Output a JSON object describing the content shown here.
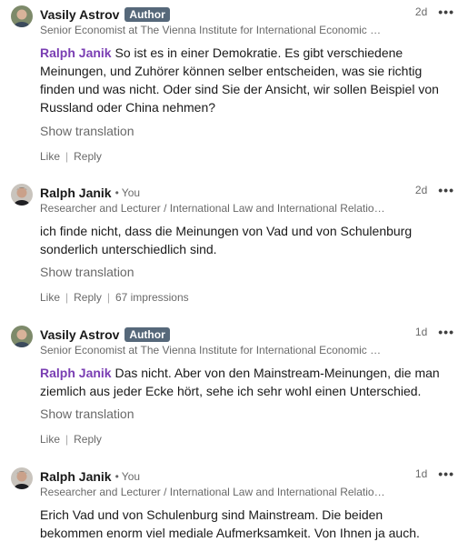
{
  "comments": [
    {
      "author": "Vasily Astrov",
      "badge": "Author",
      "you": "",
      "headline": "Senior Economist at The Vienna Institute for International Economic Studies",
      "time": "2d",
      "mention": "Ralph Janik",
      "text": "So ist es in einer Demokratie. Es gibt verschiedene Meinungen, und Zuhörer können selber entscheiden, was sie richtig finden und was nicht. Oder sind Sie der Ansicht, wir sollen Beispiel von Russland oder China nehmen?",
      "show_translation": "Show translation",
      "like": "Like",
      "reply": "Reply",
      "impressions": ""
    },
    {
      "author": "Ralph Janik",
      "badge": "",
      "you": "You",
      "headline": "Researcher and Lecturer / International Law and International Relations",
      "time": "2d",
      "mention": "",
      "text": "ich finde nicht, dass die Meinungen von Vad und von Schulenburg sonderlich unterschiedlich sind.",
      "show_translation": "Show translation",
      "like": "Like",
      "reply": "Reply",
      "impressions": "67 impressions"
    },
    {
      "author": "Vasily Astrov",
      "badge": "Author",
      "you": "",
      "headline": "Senior Economist at The Vienna Institute for International Economic Studies",
      "time": "1d",
      "mention": "Ralph Janik",
      "text": "Das nicht. Aber von den Mainstream-Meinungen, die man ziemlich aus jeder Ecke hört, sehe ich sehr wohl einen Unterschied.",
      "show_translation": "Show translation",
      "like": "Like",
      "reply": "Reply",
      "impressions": ""
    },
    {
      "author": "Ralph Janik",
      "badge": "",
      "you": "You",
      "headline": "Researcher and Lecturer / International Law and International Relations",
      "time": "1d",
      "mention": "",
      "text": "Erich Vad und von Schulenburg sind Mainstream. Die beiden bekommen enorm viel mediale Aufmerksamkeit. Von Ihnen ja auch."
    }
  ],
  "icons": {
    "more": "more-horizontal-icon"
  },
  "colors": {
    "mention": "#7a3eb3",
    "badge_bg": "#56687a"
  }
}
